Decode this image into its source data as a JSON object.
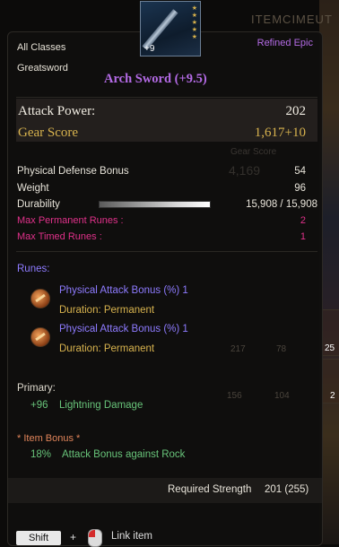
{
  "item": {
    "class": "All Classes",
    "type": "Greatsword",
    "rarity": "Refined Epic",
    "name": "Arch Sword (+9.5)",
    "enhancement_badge": "+9",
    "icon": "greatsword-icon"
  },
  "stats": {
    "attack_power_label": "Attack Power:",
    "attack_power_value": "202",
    "gear_score_label": "Gear Score",
    "gear_score_value": "1,617+10"
  },
  "attributes": [
    {
      "label": "Physical Defense Bonus",
      "value": "54"
    },
    {
      "label": "Weight",
      "value": "96"
    }
  ],
  "durability": {
    "label": "Durability",
    "value": "15,908 / 15,908",
    "fraction": 1.0
  },
  "rune_slots": [
    {
      "label": "Max Permanent Runes :",
      "value": "2"
    },
    {
      "label": "Max Timed Runes :",
      "value": "1"
    }
  ],
  "runes": {
    "header": "Runes:",
    "items": [
      {
        "name": "Physical Attack Bonus (%) 1",
        "duration": "Duration: Permanent",
        "icon": "rune-icon"
      },
      {
        "name": "Physical Attack Bonus (%) 1",
        "duration": "Duration: Permanent",
        "icon": "rune-icon"
      }
    ]
  },
  "primary": {
    "header": "Primary:",
    "value": "+96",
    "label": "Lightning Damage"
  },
  "item_bonus": {
    "header": "* Item Bonus *",
    "value": "18%",
    "label": "Attack Bonus against Rock"
  },
  "requirement": {
    "label": "Required Strength",
    "value": "201 (255)"
  },
  "hint": {
    "key": "Shift",
    "plus": "+",
    "action": "Link item"
  },
  "background": {
    "counts": [
      "217",
      "78",
      "156",
      "104",
      "25",
      "2"
    ],
    "gear_score_ghost": "Gear Score",
    "gear_score_ghost_value": "4,169",
    "banner": "ITEMCIMEUT"
  },
  "colors": {
    "rarity": "#b46be6",
    "gear_score": "#d8b34e",
    "rune_limits": "#e0318a",
    "runes": "#8e7bff",
    "primary_bonus": "#68c47a",
    "item_bonus_header": "#e0845a"
  }
}
